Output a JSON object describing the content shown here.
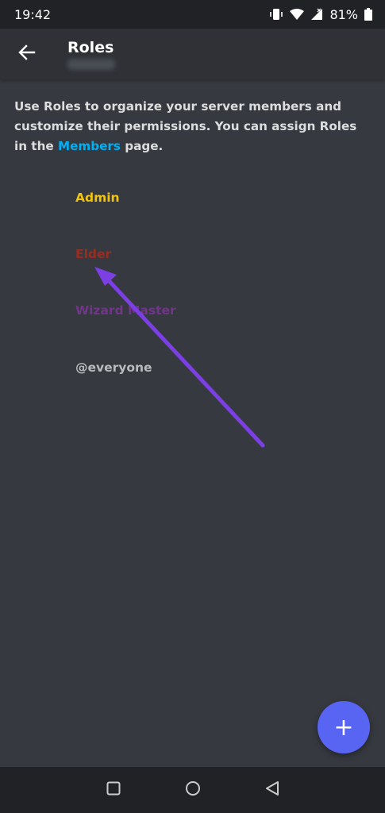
{
  "status_bar": {
    "time": "19:42",
    "battery": "81%",
    "icons": [
      "vibrate-icon",
      "wifi-icon",
      "signal-icon",
      "battery-icon"
    ]
  },
  "app_bar": {
    "title": "Roles",
    "back_icon": "arrow-left-icon"
  },
  "description": {
    "prefix": "Use Roles to organize your server members and customize their permissions. You can assign Roles in the ",
    "link": "Members",
    "suffix": " page."
  },
  "roles": [
    {
      "name": "Admin",
      "color": "#f1c40f"
    },
    {
      "name": "Elder",
      "color": "#992d22"
    },
    {
      "name": "Wizard Master",
      "color": "#71368a"
    },
    {
      "name": "@everyone",
      "color": "#b9bbbe"
    }
  ],
  "fab": {
    "label": "+"
  },
  "colors": {
    "background": "#36393f",
    "app_bar": "#2f3136",
    "accent": "#5865f2",
    "link": "#00aff4",
    "annotation_arrow": "#7b3fe4"
  },
  "nav_bar": {
    "icons": [
      "square-icon",
      "circle-icon",
      "triangle-back-icon"
    ]
  }
}
